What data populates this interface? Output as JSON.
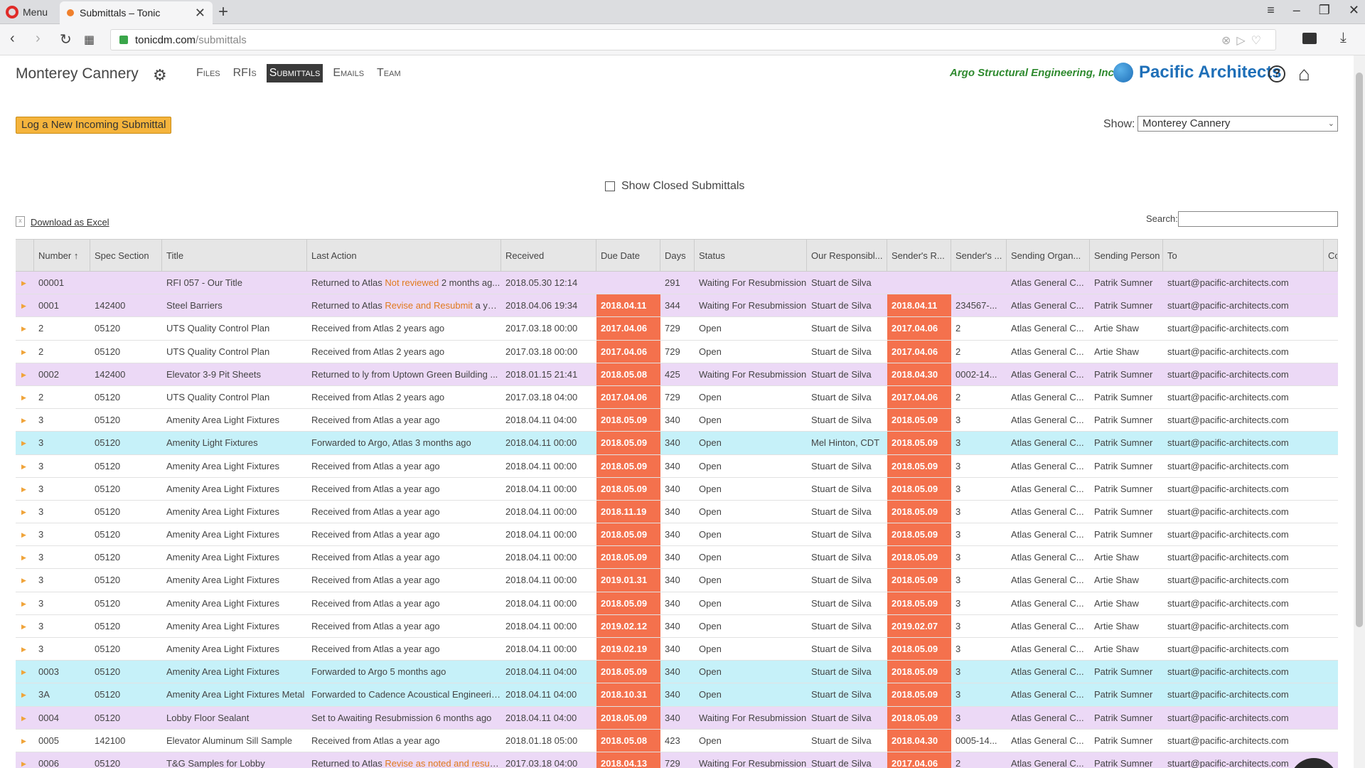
{
  "browser": {
    "menu_label": "Menu",
    "tab_title": "Submittals – Tonic",
    "url_host": "tonicdm.com",
    "url_path": "/submittals"
  },
  "header": {
    "project": "Monterey Cannery",
    "nav": [
      "Files",
      "RFIs",
      "Submittals",
      "Emails",
      "Team"
    ],
    "active_nav": "Submittals",
    "logo_argo": "Argo Structural Engineering, Inc.",
    "logo_pacific": "Pacific Architects"
  },
  "toolbar": {
    "log_button": "Log a New Incoming Submittal",
    "show_label": "Show:",
    "show_value": "Monterey Cannery",
    "closed_label": "Show Closed Submittals",
    "download_label": "Download as Excel",
    "search_label": "Search:"
  },
  "columns": [
    "Number ↑",
    "Spec Section",
    "Title",
    "Last Action",
    "Received",
    "Due Date",
    "Days",
    "Status",
    "Our Responsibl...",
    "Sender's R...",
    "Sender's ...",
    "Sending Organ...",
    "Sending Person",
    "To",
    "Cc"
  ],
  "rows": [
    {
      "color": "purple",
      "num": "00001",
      "spec": "",
      "title": "RFI 057 - Our Title",
      "la_pre": "Returned to Atlas ",
      "la_hl": "Not reviewed",
      "la_post": " 2 months ag...",
      "recv": "2018.05.30 12:14",
      "due": "",
      "days": "291",
      "status": "Waiting For Resubmission",
      "resp": "Stuart de Silva",
      "srd": "",
      "sn": "",
      "org": "Atlas General C...",
      "person": "Patrik Sumner",
      "to": "stuart@pacific-architects.com"
    },
    {
      "color": "purple",
      "num": "0001",
      "spec": "142400",
      "title": "Steel Barriers",
      "la_pre": "Returned to Atlas ",
      "la_hl": "Revise and Resubmit",
      "la_post": " a yea...",
      "recv": "2018.04.06 19:34",
      "due": "2018.04.11",
      "days": "344",
      "status": "Waiting For Resubmission",
      "resp": "Stuart de Silva",
      "srd": "2018.04.11",
      "sn": "234567-...",
      "org": "Atlas General C...",
      "person": "Patrik Sumner",
      "to": "stuart@pacific-architects.com"
    },
    {
      "color": "",
      "num": "2",
      "spec": "05120",
      "title": "UTS Quality Control Plan",
      "la_pre": "Received from Atlas 2 years ago",
      "la_hl": "",
      "la_post": "",
      "recv": "2017.03.18 00:00",
      "due": "2017.04.06",
      "days": "729",
      "status": "Open",
      "resp": "Stuart de Silva",
      "srd": "2017.04.06",
      "sn": "2",
      "org": "Atlas General C...",
      "person": "Artie Shaw",
      "to": "stuart@pacific-architects.com"
    },
    {
      "color": "",
      "num": "2",
      "spec": "05120",
      "title": "UTS Quality Control Plan",
      "la_pre": "Received from Atlas 2 years ago",
      "la_hl": "",
      "la_post": "",
      "recv": "2017.03.18 00:00",
      "due": "2017.04.06",
      "days": "729",
      "status": "Open",
      "resp": "Stuart de Silva",
      "srd": "2017.04.06",
      "sn": "2",
      "org": "Atlas General C...",
      "person": "Artie Shaw",
      "to": "stuart@pacific-architects.com"
    },
    {
      "color": "purple",
      "num": "0002",
      "spec": "142400",
      "title": "Elevator 3-9 Pit Sheets",
      "la_pre": "Returned to ly from Uptown Green Building ...",
      "la_hl": "",
      "la_post": "",
      "recv": "2018.01.15 21:41",
      "due": "2018.05.08",
      "days": "425",
      "status": "Waiting For Resubmission",
      "resp": "Stuart de Silva",
      "srd": "2018.04.30",
      "sn": "0002-14...",
      "org": "Atlas General C...",
      "person": "Patrik Sumner",
      "to": "stuart@pacific-architects.com"
    },
    {
      "color": "",
      "num": "2",
      "spec": "05120",
      "title": "UTS Quality Control Plan",
      "la_pre": "Received from Atlas 2 years ago",
      "la_hl": "",
      "la_post": "",
      "recv": "2017.03.18 04:00",
      "due": "2017.04.06",
      "days": "729",
      "status": "Open",
      "resp": "Stuart de Silva",
      "srd": "2017.04.06",
      "sn": "2",
      "org": "Atlas General C...",
      "person": "Patrik Sumner",
      "to": "stuart@pacific-architects.com"
    },
    {
      "color": "",
      "num": "3",
      "spec": "05120",
      "title": "Amenity Area Light Fixtures",
      "la_pre": "Received from Atlas a year ago",
      "la_hl": "",
      "la_post": "",
      "recv": "2018.04.11 04:00",
      "due": "2018.05.09",
      "days": "340",
      "status": "Open",
      "resp": "Stuart de Silva",
      "srd": "2018.05.09",
      "sn": "3",
      "org": "Atlas General C...",
      "person": "Patrik Sumner",
      "to": "stuart@pacific-architects.com"
    },
    {
      "color": "cyan",
      "num": "3",
      "spec": "05120",
      "title": "Amenity Light Fixtures",
      "la_pre": "Forwarded to Argo, Atlas 3 months ago",
      "la_hl": "",
      "la_post": "",
      "recv": "2018.04.11 00:00",
      "due": "2018.05.09",
      "days": "340",
      "status": "Open",
      "resp": "Mel Hinton, CDT",
      "srd": "2018.05.09",
      "sn": "3",
      "org": "Atlas General C...",
      "person": "Patrik Sumner",
      "to": "stuart@pacific-architects.com"
    },
    {
      "color": "",
      "num": "3",
      "spec": "05120",
      "title": "Amenity Area Light Fixtures",
      "la_pre": "Received from Atlas a year ago",
      "la_hl": "",
      "la_post": "",
      "recv": "2018.04.11 00:00",
      "due": "2018.05.09",
      "days": "340",
      "status": "Open",
      "resp": "Stuart de Silva",
      "srd": "2018.05.09",
      "sn": "3",
      "org": "Atlas General C...",
      "person": "Patrik Sumner",
      "to": "stuart@pacific-architects.com"
    },
    {
      "color": "",
      "num": "3",
      "spec": "05120",
      "title": "Amenity Area Light Fixtures",
      "la_pre": "Received from Atlas a year ago",
      "la_hl": "",
      "la_post": "",
      "recv": "2018.04.11 00:00",
      "due": "2018.05.09",
      "days": "340",
      "status": "Open",
      "resp": "Stuart de Silva",
      "srd": "2018.05.09",
      "sn": "3",
      "org": "Atlas General C...",
      "person": "Patrik Sumner",
      "to": "stuart@pacific-architects.com"
    },
    {
      "color": "",
      "num": "3",
      "spec": "05120",
      "title": "Amenity Area Light Fixtures",
      "la_pre": "Received from Atlas a year ago",
      "la_hl": "",
      "la_post": "",
      "recv": "2018.04.11 00:00",
      "due": "2018.11.19",
      "days": "340",
      "status": "Open",
      "resp": "Stuart de Silva",
      "srd": "2018.05.09",
      "sn": "3",
      "org": "Atlas General C...",
      "person": "Patrik Sumner",
      "to": "stuart@pacific-architects.com"
    },
    {
      "color": "",
      "num": "3",
      "spec": "05120",
      "title": "Amenity Area Light Fixtures",
      "la_pre": "Received from Atlas a year ago",
      "la_hl": "",
      "la_post": "",
      "recv": "2018.04.11 00:00",
      "due": "2018.05.09",
      "days": "340",
      "status": "Open",
      "resp": "Stuart de Silva",
      "srd": "2018.05.09",
      "sn": "3",
      "org": "Atlas General C...",
      "person": "Patrik Sumner",
      "to": "stuart@pacific-architects.com"
    },
    {
      "color": "",
      "num": "3",
      "spec": "05120",
      "title": "Amenity Area Light Fixtures",
      "la_pre": "Received from Atlas a year ago",
      "la_hl": "",
      "la_post": "",
      "recv": "2018.04.11 00:00",
      "due": "2018.05.09",
      "days": "340",
      "status": "Open",
      "resp": "Stuart de Silva",
      "srd": "2018.05.09",
      "sn": "3",
      "org": "Atlas General C...",
      "person": "Artie Shaw",
      "to": "stuart@pacific-architects.com"
    },
    {
      "color": "",
      "num": "3",
      "spec": "05120",
      "title": "Amenity Area Light Fixtures",
      "la_pre": "Received from Atlas a year ago",
      "la_hl": "",
      "la_post": "",
      "recv": "2018.04.11 00:00",
      "due": "2019.01.31",
      "days": "340",
      "status": "Open",
      "resp": "Stuart de Silva",
      "srd": "2018.05.09",
      "sn": "3",
      "org": "Atlas General C...",
      "person": "Artie Shaw",
      "to": "stuart@pacific-architects.com"
    },
    {
      "color": "",
      "num": "3",
      "spec": "05120",
      "title": "Amenity Area Light Fixtures",
      "la_pre": "Received from Atlas a year ago",
      "la_hl": "",
      "la_post": "",
      "recv": "2018.04.11 00:00",
      "due": "2018.05.09",
      "days": "340",
      "status": "Open",
      "resp": "Stuart de Silva",
      "srd": "2018.05.09",
      "sn": "3",
      "org": "Atlas General C...",
      "person": "Artie Shaw",
      "to": "stuart@pacific-architects.com"
    },
    {
      "color": "",
      "num": "3",
      "spec": "05120",
      "title": "Amenity Area Light Fixtures",
      "la_pre": "Received from Atlas a year ago",
      "la_hl": "",
      "la_post": "",
      "recv": "2018.04.11 00:00",
      "due": "2019.02.12",
      "days": "340",
      "status": "Open",
      "resp": "Stuart de Silva",
      "srd": "2019.02.07",
      "sn": "3",
      "org": "Atlas General C...",
      "person": "Artie Shaw",
      "to": "stuart@pacific-architects.com"
    },
    {
      "color": "",
      "num": "3",
      "spec": "05120",
      "title": "Amenity Area Light Fixtures",
      "la_pre": "Received from Atlas a year ago",
      "la_hl": "",
      "la_post": "",
      "recv": "2018.04.11 00:00",
      "due": "2019.02.19",
      "days": "340",
      "status": "Open",
      "resp": "Stuart de Silva",
      "srd": "2018.05.09",
      "sn": "3",
      "org": "Atlas General C...",
      "person": "Artie Shaw",
      "to": "stuart@pacific-architects.com"
    },
    {
      "color": "cyan",
      "num": "0003",
      "spec": "05120",
      "title": "Amenity Area Light Fixtures",
      "la_pre": "Forwarded to Argo 5 months ago",
      "la_hl": "",
      "la_post": "",
      "recv": "2018.04.11 04:00",
      "due": "2018.05.09",
      "days": "340",
      "status": "Open",
      "resp": "Stuart de Silva",
      "srd": "2018.05.09",
      "sn": "3",
      "org": "Atlas General C...",
      "person": "Patrik Sumner",
      "to": "stuart@pacific-architects.com"
    },
    {
      "color": "cyan",
      "num": "3A",
      "spec": "05120",
      "title": "Amenity Area Light Fixtures Metal",
      "la_pre": "Forwarded to Cadence Acoustical Engineerin...",
      "la_hl": "",
      "la_post": "",
      "recv": "2018.04.11 04:00",
      "due": "2018.10.31",
      "days": "340",
      "status": "Open",
      "resp": "Stuart de Silva",
      "srd": "2018.05.09",
      "sn": "3",
      "org": "Atlas General C...",
      "person": "Patrik Sumner",
      "to": "stuart@pacific-architects.com"
    },
    {
      "color": "purple",
      "num": "0004",
      "spec": "05120",
      "title": "Lobby Floor Sealant",
      "la_pre": "Set to Awaiting Resubmission 6 months ago",
      "la_hl": "",
      "la_post": "",
      "recv": "2018.04.11 04:00",
      "due": "2018.05.09",
      "days": "340",
      "status": "Waiting For Resubmission",
      "resp": "Stuart de Silva",
      "srd": "2018.05.09",
      "sn": "3",
      "org": "Atlas General C...",
      "person": "Patrik Sumner",
      "to": "stuart@pacific-architects.com"
    },
    {
      "color": "",
      "num": "0005",
      "spec": "142100",
      "title": "Elevator Aluminum Sill Sample",
      "la_pre": "Received from Atlas a year ago",
      "la_hl": "",
      "la_post": "",
      "recv": "2018.01.18 05:00",
      "due": "2018.05.08",
      "days": "423",
      "status": "Open",
      "resp": "Stuart de Silva",
      "srd": "2018.04.30",
      "sn": "0005-14...",
      "org": "Atlas General C...",
      "person": "Patrik Sumner",
      "to": "stuart@pacific-architects.com"
    },
    {
      "color": "purple",
      "num": "0006",
      "spec": "05120",
      "title": "T&G Samples for Lobby",
      "la_pre": "Returned to Atlas ",
      "la_hl": "Revise as noted and resub...",
      "la_post": "",
      "recv": "2017.03.18 04:00",
      "due": "2018.04.13",
      "days": "729",
      "status": "Waiting For Resubmission",
      "resp": "Stuart de Silva",
      "srd": "2017.04.06",
      "sn": "2",
      "org": "Atlas General C...",
      "person": "Patrik Sumner",
      "to": "stuart@pacific-architects.com"
    }
  ],
  "colors": {
    "due_box": "#f4714d",
    "purple_row": "#ecd9f6",
    "cyan_row": "#c6f1f9",
    "log_button": "#f5b43c"
  },
  "icons": {
    "settings": "gear-icon",
    "help": "help-icon",
    "home": "home-icon",
    "chat": "chat-icon"
  }
}
